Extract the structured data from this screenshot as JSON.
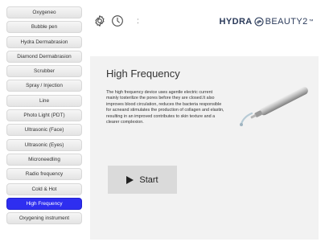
{
  "sidebar": {
    "items": [
      {
        "label": "Oxygeneo"
      },
      {
        "label": "Bubble pen"
      },
      {
        "label": "Hydra Dermabrasion"
      },
      {
        "label": "Diamond Dermabrasion"
      },
      {
        "label": "Scrubber"
      },
      {
        "label": "Spray / Injection"
      },
      {
        "label": "Line"
      },
      {
        "label": "Photo Light (PDT)"
      },
      {
        "label": "Ultrasonic (Face)"
      },
      {
        "label": "Ultrasonic (Eyes)"
      },
      {
        "label": "Microneedling"
      },
      {
        "label": "Radio frequency"
      },
      {
        "label": "Cold & Hot"
      },
      {
        "label": "High Frequency",
        "active": true
      },
      {
        "label": "Oxygening instrument"
      }
    ]
  },
  "topbar": {
    "icons": [
      "settings-gear-icon",
      "clock-icon"
    ],
    "separator": ":"
  },
  "brand": {
    "part1": "HYDRA",
    "part2": "BEAUTY2",
    "mark": "™",
    "logo_icon": "swirl-logo-icon",
    "color": "#2a3a5a"
  },
  "panel": {
    "title": "High Frequency",
    "description": "The high frequency device uses agentle electric current mainly tosterilize the pores before they are closed.It also improves blood circulation, reduces the bacteria responsible for acneand stimulates the production of collagen and elastin, resulting in an improved contributes to skin texture and a clearer complexion.",
    "device_image": "high-frequency-wand",
    "start_label": "Start",
    "start_icon": "play-icon"
  },
  "colors": {
    "accent": "#2e2ef0",
    "panel_bg": "#f2f2f2",
    "button_bg": "#dadada"
  }
}
